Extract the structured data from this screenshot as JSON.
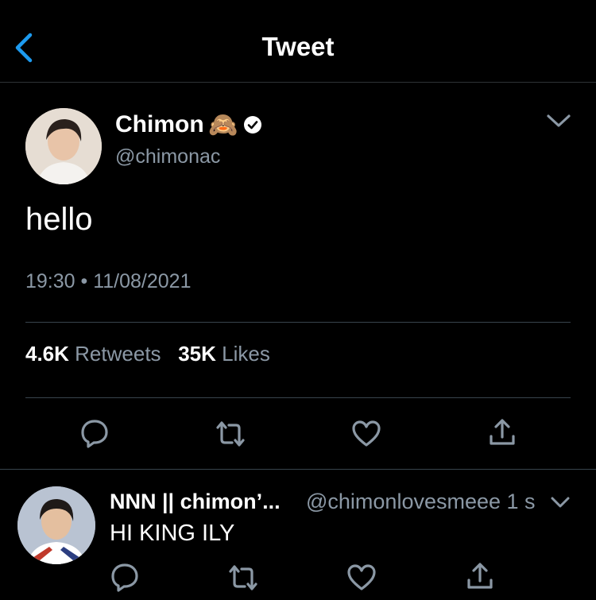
{
  "header": {
    "title": "Tweet"
  },
  "tweet": {
    "author_name": "Chimon",
    "author_emoji": "🙈",
    "handle": "@chimonac",
    "text": "hello",
    "timestamp": "19:30 • 11/08/2021",
    "retweets_count": "4.6K",
    "retweets_label": "Retweets",
    "likes_count": "35K",
    "likes_label": "Likes"
  },
  "reply": {
    "author_name": "NNN || chimon’...",
    "handle_time": "@chimonlovesmeee 1 s",
    "text": "HI KING ILY"
  },
  "colors": {
    "accent": "#1d9bf0",
    "secondary_text": "#8b98a5",
    "divider": "#38444d"
  }
}
